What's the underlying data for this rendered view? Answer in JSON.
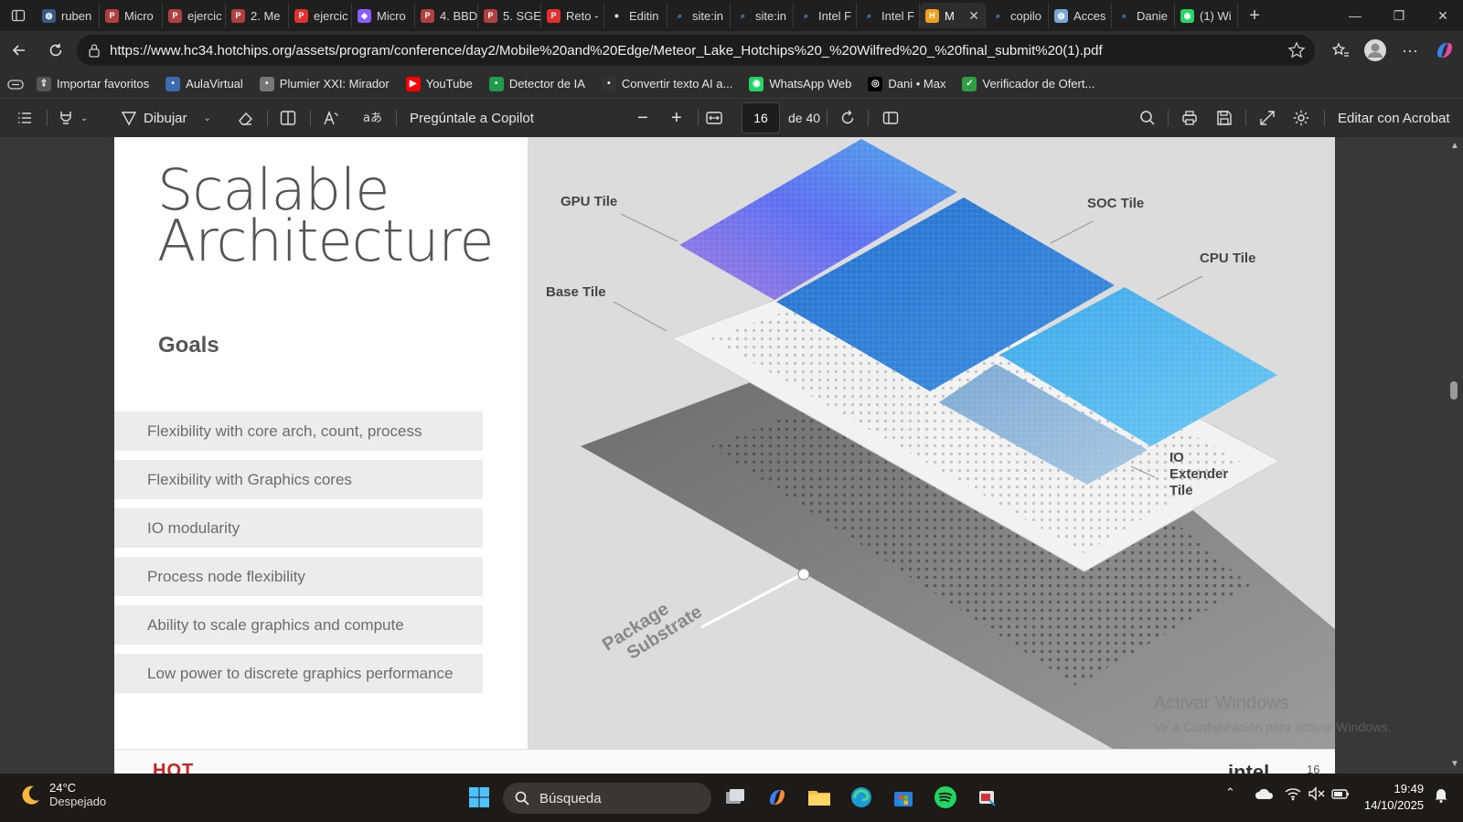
{
  "browser": {
    "tabs": [
      {
        "label": "ruben",
        "favicon": "globe-icon",
        "color": "#3a5a8a"
      },
      {
        "label": "Micro",
        "favicon": "pdf-icon",
        "color": "#b04040"
      },
      {
        "label": "ejercic",
        "favicon": "pdf-icon",
        "color": "#b04040"
      },
      {
        "label": "2. Me",
        "favicon": "pdf-icon",
        "color": "#b04040"
      },
      {
        "label": "ejercic",
        "favicon": "pdf-icon",
        "color": "#e03030"
      },
      {
        "label": "Micro",
        "favicon": "copilot-icon",
        "color": "#8a5cff"
      },
      {
        "label": "4. BBD",
        "favicon": "pdf-icon",
        "color": "#b04040"
      },
      {
        "label": "5. SGE",
        "favicon": "pdf-icon",
        "color": "#b04040"
      },
      {
        "label": "Reto -",
        "favicon": "pdf-icon",
        "color": "#e03030"
      },
      {
        "label": "Editin",
        "favicon": "github-icon",
        "color": "#ffffff"
      },
      {
        "label": "site:in",
        "favicon": "search-icon",
        "color": "#4a9aea"
      },
      {
        "label": "site:in",
        "favicon": "search-icon",
        "color": "#4a9aea"
      },
      {
        "label": "Intel F",
        "favicon": "search-icon",
        "color": "#4a9aea"
      },
      {
        "label": "Intel F",
        "favicon": "search-icon",
        "color": "#4a9aea"
      },
      {
        "label": "M",
        "favicon": "hotchips-icon",
        "color": "#f0a020",
        "active": true
      },
      {
        "label": "copilo",
        "favicon": "search-icon",
        "color": "#4a9aea"
      },
      {
        "label": "Acces",
        "favicon": "globe-icon",
        "color": "#7aa7d8"
      },
      {
        "label": "Danie",
        "favicon": "search-icon",
        "color": "#4a9aea"
      },
      {
        "label": "(1) Wi",
        "favicon": "whatsapp-icon",
        "color": "#25d366"
      }
    ],
    "url": "https://www.hc34.hotchips.org/assets/program/conference/day2/Mobile%20and%20Edge/Meteor_Lake_Hotchips%20_%20Wilfred%20_%20final_submit%20(1).pdf",
    "favorites": [
      {
        "label": "Importar favoritos",
        "icon": "import-icon",
        "color": "#555555"
      },
      {
        "label": "AulaVirtual",
        "icon": "globe-icon",
        "color": "#3a6ab0"
      },
      {
        "label": "Plumier XXI: Mirador",
        "icon": "plumier-icon",
        "color": "#777777"
      },
      {
        "label": "YouTube",
        "icon": "youtube-icon",
        "color": "#ff0000"
      },
      {
        "label": "Detector de IA",
        "icon": "detector-icon",
        "color": "#1e9e4a"
      },
      {
        "label": "Convertir texto AI a...",
        "icon": "convert-icon",
        "color": "#333333"
      },
      {
        "label": "WhatsApp Web",
        "icon": "whatsapp-icon",
        "color": "#25d366"
      },
      {
        "label": "Dani • Max",
        "icon": "max-icon",
        "color": "#000000"
      },
      {
        "label": "Verificador de Ofert...",
        "icon": "check-icon",
        "color": "#2ea043"
      }
    ]
  },
  "pdf_toolbar": {
    "draw_label": "Dibujar",
    "copilot_label": "Pregúntale a Copilot",
    "page_current": "16",
    "page_total": "de 40",
    "acrobat_label": "Editar con Acrobat"
  },
  "slide": {
    "title_line1": "Scalable",
    "title_line2": "Architecture",
    "goals_heading": "Goals",
    "goals": [
      "Flexibility with core arch, count, process",
      "Flexibility with Graphics cores",
      "IO modularity",
      "Process node flexibility",
      "Ability to scale graphics and compute",
      "Low power to discrete graphics performance"
    ],
    "labels": {
      "gpu": "GPU Tile",
      "soc": "SOC Tile",
      "cpu": "CPU Tile",
      "base": "Base Tile",
      "io_line1": "IO",
      "io_line2": "Extender",
      "io_line3": "Tile",
      "substrate_line1": "Package",
      "substrate_line2": "Substrate"
    },
    "footer_left": "HOT",
    "footer_logo": "intel",
    "footer_page": "16",
    "watermark_title": "Activar Windows",
    "watermark_sub": "Ve a Configuración para activar Windows."
  },
  "taskbar": {
    "temp": "24°C",
    "weather": "Despejado",
    "search_placeholder": "Búsqueda",
    "time": "19:49",
    "date": "14/10/2025"
  }
}
